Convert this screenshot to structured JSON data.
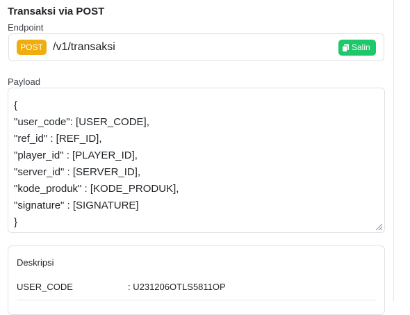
{
  "section": {
    "title": "Transaksi via POST"
  },
  "endpoint": {
    "label": "Endpoint",
    "method": "POST",
    "path": "/v1/transaksi",
    "copy_label": "Salin",
    "copy_icon": "copy-icon",
    "method_color": "#f0ad0e",
    "copy_color": "#1ec76a"
  },
  "payload": {
    "label": "Payload",
    "lines": [
      "{",
      "\"user_code\": [USER_CODE],",
      "\"ref_id\" : [REF_ID],",
      "\"player_id\" : [PLAYER_ID],",
      "\"server_id\" : [SERVER_ID],",
      "\"kode_produk\" : [KODE_PRODUK],",
      "\"signature\" : [SIGNATURE]",
      "}"
    ]
  },
  "description": {
    "title": "Deskripsi",
    "rows": [
      {
        "key": "USER_CODE",
        "value": ": U231206OTLS5811OP"
      }
    ]
  }
}
